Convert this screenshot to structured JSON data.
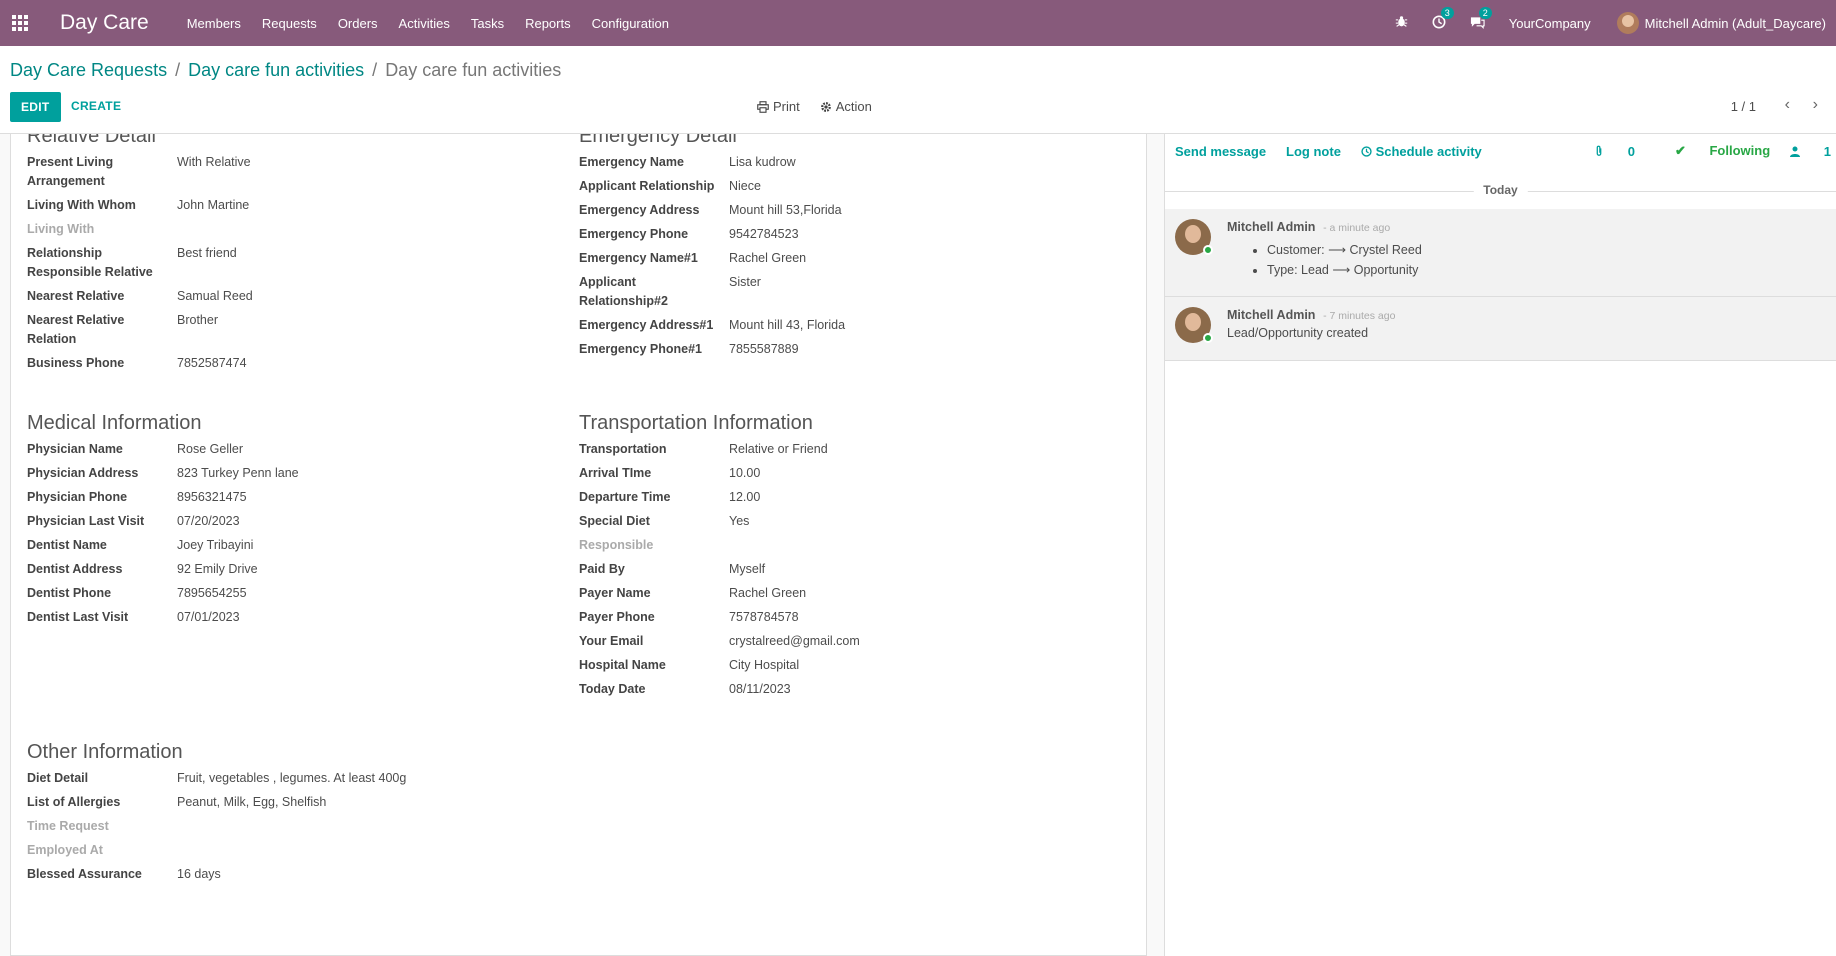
{
  "navbar": {
    "brand": "Day Care",
    "menu": [
      "Members",
      "Requests",
      "Orders",
      "Activities",
      "Tasks",
      "Reports",
      "Configuration"
    ],
    "activity_badge": "3",
    "message_badge": "2",
    "company": "YourCompany",
    "user": "Mitchell Admin (Adult_Daycare)"
  },
  "breadcrumb": {
    "level1": "Day Care Requests",
    "level2": "Day care fun activities",
    "current": "Day care fun activities"
  },
  "toolbar": {
    "edit": "EDIT",
    "create": "CREATE",
    "print": "Print",
    "action": "Action",
    "pager": "1 / 1"
  },
  "form": {
    "relative": {
      "title": "Relative Detail",
      "rows": [
        {
          "label": "Present Living Arrangement",
          "value": "With Relative"
        },
        {
          "label": "Living With Whom",
          "value": "John Martine"
        },
        {
          "label": "Living With",
          "value": ""
        },
        {
          "label": "Relationship Responsible Relative",
          "value": "Best friend"
        },
        {
          "label": "Nearest Relative",
          "value": "Samual Reed"
        },
        {
          "label": "Nearest Relative Relation",
          "value": "Brother"
        },
        {
          "label": "Business Phone",
          "value": "7852587474"
        }
      ]
    },
    "emergency": {
      "title": "Emergency Detail",
      "rows": [
        {
          "label": "Emergency Name",
          "value": "Lisa kudrow"
        },
        {
          "label": "Applicant Relationship",
          "value": "Niece"
        },
        {
          "label": "Emergency Address",
          "value": "Mount hill 53,Florida"
        },
        {
          "label": "Emergency Phone",
          "value": "9542784523"
        },
        {
          "label": "Emergency Name#1",
          "value": "Rachel Green"
        },
        {
          "label": "Applicant Relationship#2",
          "value": "Sister"
        },
        {
          "label": "Emergency Address#1",
          "value": "Mount hill 43, Florida"
        },
        {
          "label": "Emergency Phone#1",
          "value": "7855587889"
        }
      ]
    },
    "medical": {
      "title": "Medical Information",
      "rows": [
        {
          "label": "Physician Name",
          "value": "Rose Geller"
        },
        {
          "label": "Physician Address",
          "value": "823 Turkey Penn lane"
        },
        {
          "label": "Physician Phone",
          "value": "8956321475"
        },
        {
          "label": "Physician Last Visit",
          "value": "07/20/2023"
        },
        {
          "label": "Dentist Name",
          "value": "Joey Tribayini"
        },
        {
          "label": "Dentist Address",
          "value": "92 Emily Drive"
        },
        {
          "label": "Dentist Phone",
          "value": "7895654255"
        },
        {
          "label": "Dentist Last Visit",
          "value": "07/01/2023"
        }
      ]
    },
    "transport": {
      "title": "Transportation Information",
      "rows": [
        {
          "label": "Transportation",
          "value": "Relative or Friend"
        },
        {
          "label": "Arrival TIme",
          "value": "10.00"
        },
        {
          "label": "Departure Time",
          "value": "12.00"
        },
        {
          "label": "Special Diet",
          "value": "Yes"
        },
        {
          "label": "Responsible",
          "value": ""
        },
        {
          "label": "Paid By",
          "value": "Myself"
        },
        {
          "label": "Payer Name",
          "value": "Rachel Green"
        },
        {
          "label": "Payer Phone",
          "value": "7578784578"
        },
        {
          "label": "Your Email",
          "value": "crystalreed@gmail.com"
        },
        {
          "label": "Hospital Name",
          "value": "City Hospital"
        },
        {
          "label": "Today Date",
          "value": "08/11/2023"
        }
      ]
    },
    "other": {
      "title": "Other Information",
      "rows": [
        {
          "label": "Diet Detail",
          "value": "Fruit, vegetables , legumes. At least 400g"
        },
        {
          "label": "List of Allergies",
          "value": "Peanut, Milk, Egg, Shelfish"
        },
        {
          "label": "Time Request",
          "value": ""
        },
        {
          "label": "Employed At",
          "value": ""
        },
        {
          "label": "Blessed Assurance",
          "value": "16 days"
        }
      ]
    }
  },
  "chatter": {
    "send_message": "Send message",
    "log_note": "Log note",
    "schedule_activity": "Schedule activity",
    "attachments": "0",
    "following": "Following",
    "followers": "1",
    "today": "Today",
    "messages": [
      {
        "author": "Mitchell Admin",
        "time": "- a minute ago",
        "changes": [
          "Customer: ⟶ Crystel Reed",
          "Type: Lead ⟶ Opportunity"
        ]
      },
      {
        "author": "Mitchell Admin",
        "time": "- 7 minutes ago",
        "body": "Lead/Opportunity created"
      }
    ]
  }
}
